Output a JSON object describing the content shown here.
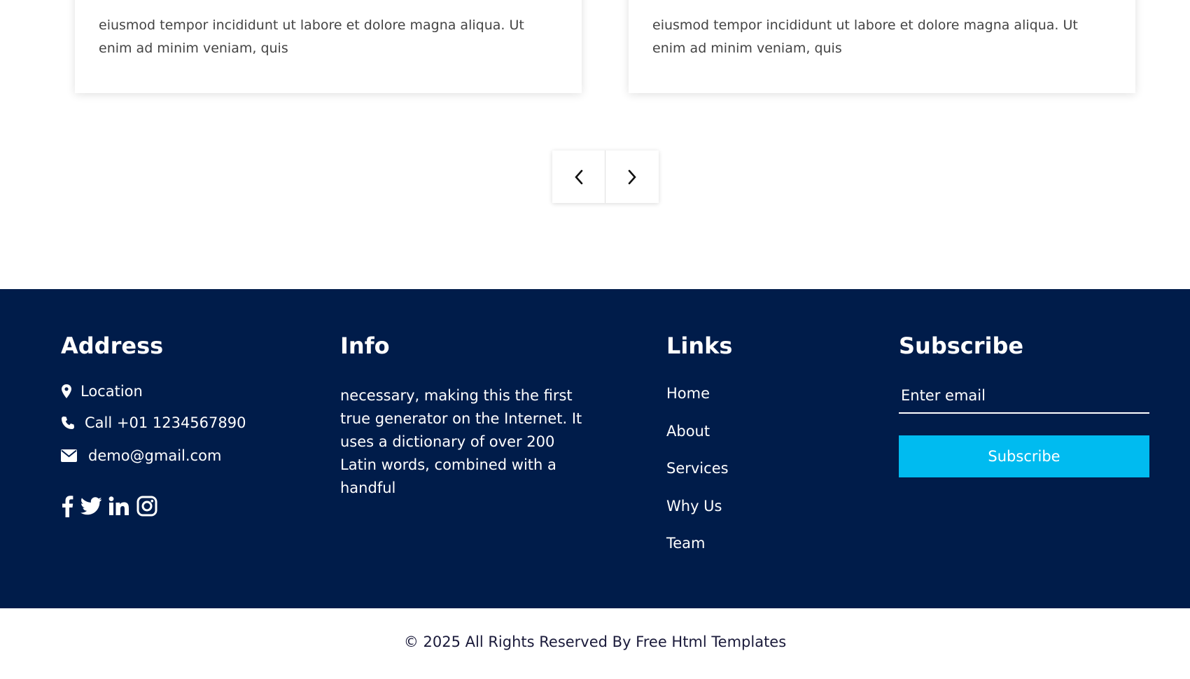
{
  "testimonials": [
    {
      "text": "eiusmod tempor incididunt ut labore et dolore magna aliqua. Ut enim ad minim veniam, quis"
    },
    {
      "text": "eiusmod tempor incididunt ut labore et dolore magna aliqua. Ut enim ad minim veniam, quis"
    }
  ],
  "carousel": {
    "prev_icon": "chevron-left-icon",
    "next_icon": "chevron-right-icon"
  },
  "footer": {
    "address": {
      "heading": "Address",
      "location": "Location",
      "phone": "Call +01 1234567890",
      "email": "demo@gmail.com",
      "social_icons": [
        "facebook-icon",
        "twitter-icon",
        "linkedin-icon",
        "instagram-icon"
      ]
    },
    "info": {
      "heading": "Info",
      "text": "necessary, making this the first true generator on the Internet. It uses a dictionary of over 200 Latin words, combined with a handful"
    },
    "links": {
      "heading": "Links",
      "items": [
        "Home",
        "About",
        "Services",
        "Why Us",
        "Team"
      ]
    },
    "subscribe": {
      "heading": "Subscribe",
      "placeholder": "Enter email",
      "button": "Subscribe"
    }
  },
  "copyright": "© 2025 All Rights Reserved By Free Html Templates",
  "colors": {
    "footer_bg": "#001c4a",
    "accent": "#00bbf0"
  }
}
